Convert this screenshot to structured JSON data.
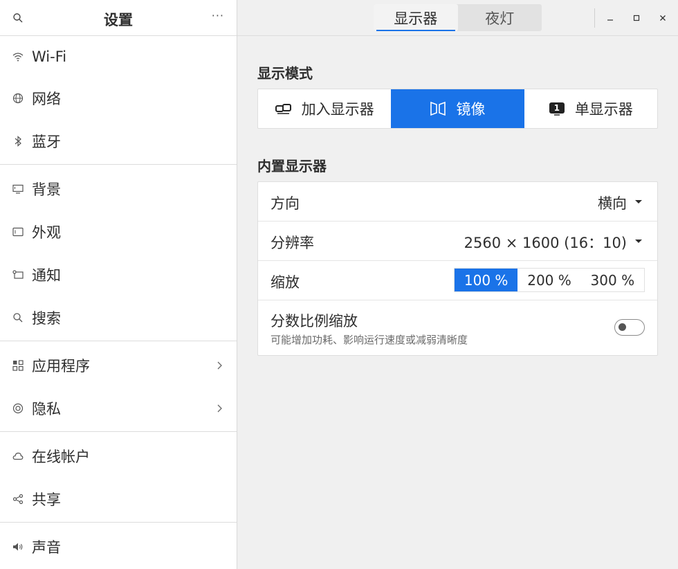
{
  "sidebar": {
    "title": "设置",
    "more_label": "···",
    "items": [
      {
        "label": "Wi-Fi",
        "icon": "wifi-icon"
      },
      {
        "label": "网络",
        "icon": "network-icon"
      },
      {
        "label": "蓝牙",
        "icon": "bluetooth-icon"
      },
      {
        "label": "背景",
        "icon": "background-icon"
      },
      {
        "label": "外观",
        "icon": "appearance-icon"
      },
      {
        "label": "通知",
        "icon": "notification-icon"
      },
      {
        "label": "搜索",
        "icon": "search-icon"
      },
      {
        "label": "应用程序",
        "icon": "apps-icon"
      },
      {
        "label": "隐私",
        "icon": "privacy-icon"
      },
      {
        "label": "在线帐户",
        "icon": "cloud-icon"
      },
      {
        "label": "共享",
        "icon": "share-icon"
      },
      {
        "label": "声音",
        "icon": "sound-icon"
      }
    ]
  },
  "header": {
    "tabs": [
      {
        "label": "显示器",
        "active": true
      },
      {
        "label": "夜灯",
        "active": false
      }
    ]
  },
  "display_mode": {
    "title": "显示模式",
    "options": [
      {
        "label": "加入显示器",
        "icon": "join-displays-icon",
        "active": false
      },
      {
        "label": "镜像",
        "icon": "mirror-icon",
        "active": true
      },
      {
        "label": "单显示器",
        "icon": "single-display-icon",
        "active": false
      }
    ],
    "single_badge": "1"
  },
  "builtin": {
    "title": "内置显示器",
    "orientation": {
      "label": "方向",
      "value": "横向"
    },
    "resolution": {
      "label": "分辨率",
      "value": "2560 × 1600 (16：10)"
    },
    "scale": {
      "label": "缩放",
      "options": [
        "100 %",
        "200 %",
        "300 %"
      ],
      "selected": "100 %"
    },
    "fractional": {
      "label": "分数比例缩放",
      "subtitle": "可能增加功耗、影响运行速度或减弱清晰度",
      "enabled": false
    }
  },
  "colors": {
    "accent": "#1a73e8",
    "sidebar_bg": "#ffffff",
    "content_bg": "#f0f0f0"
  }
}
